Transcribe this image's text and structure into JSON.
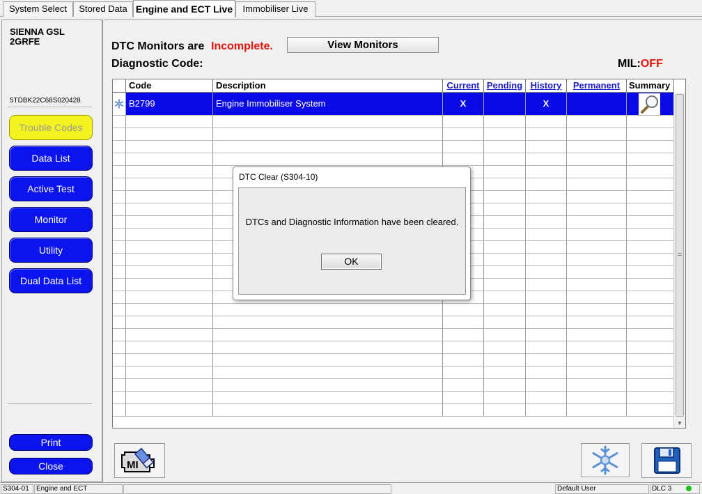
{
  "tabs": [
    "System Select",
    "Stored Data",
    "Engine and ECT Live",
    "Immobiliser Live"
  ],
  "vehicle": {
    "model": "SIENNA GSL",
    "engine": "2GRFE",
    "vin": "5TDBK22C68S020428"
  },
  "nav": {
    "items": [
      "Trouble Codes",
      "Data List",
      "Active Test",
      "Monitor",
      "Utility",
      "Dual Data List"
    ],
    "print": "Print",
    "close": "Close"
  },
  "header": {
    "monitors_label": "DTC Monitors are",
    "monitors_status": "Incomplete.",
    "view_monitors": "View Monitors",
    "diag_label": "Diagnostic Code:",
    "mil_label": "MIL:",
    "mil_value": "OFF"
  },
  "table": {
    "columns": [
      "Code",
      "Description",
      "Current",
      "Pending",
      "History",
      "Permanent",
      "Summary"
    ],
    "rows": [
      {
        "code": "B2799",
        "description": "Engine Immobiliser System",
        "current": "X",
        "pending": "",
        "history": "X",
        "permanent": ""
      }
    ]
  },
  "dialog": {
    "title": "DTC Clear (S304-10)",
    "message": "DTCs and Diagnostic Information have been cleared.",
    "ok": "OK"
  },
  "status": {
    "screen_id": "S304-01",
    "section": "Engine and ECT",
    "user": "Default User",
    "port": "DLC 3"
  },
  "icons": {
    "mil": "mil-eraser-icon",
    "freeze": "snowflake-icon",
    "save": "floppy-disk-icon",
    "summary": "magnifier-icon",
    "row": "freeze-frame-icon"
  },
  "colors": {
    "nav_button": "#0b14ee",
    "active_nav": "#f3f320",
    "selected_row": "#0a0ae8",
    "alert_red": "#e3140c",
    "link_blue": "#1a1acc"
  }
}
